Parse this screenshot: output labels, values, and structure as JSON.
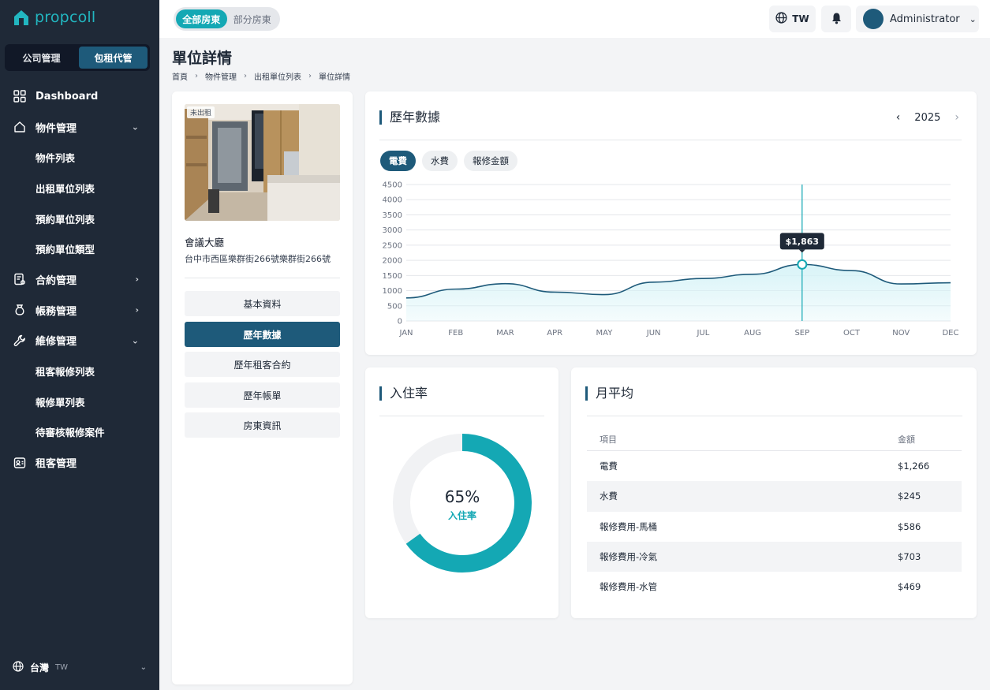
{
  "brand": {
    "name": "propcoll",
    "accent": "#14a8b4",
    "primary": "#1e5a7a"
  },
  "sidebar": {
    "segments": [
      {
        "label": "公司管理",
        "active": false
      },
      {
        "label": "包租代管",
        "active": true
      }
    ],
    "nav": [
      {
        "label": "Dashboard",
        "icon": "grid-icon"
      },
      {
        "label": "物件管理",
        "icon": "home-icon",
        "expanded": true
      },
      {
        "label": "物件列表"
      },
      {
        "label": "出租單位列表"
      },
      {
        "label": "預約單位列表"
      },
      {
        "label": "預約單位類型"
      },
      {
        "label": "合約管理",
        "icon": "contract-icon"
      },
      {
        "label": "帳務管理",
        "icon": "moneybag-icon"
      },
      {
        "label": "維修管理",
        "icon": "wrench-icon",
        "expanded": true
      },
      {
        "label": "租客報修列表"
      },
      {
        "label": "報修單列表"
      },
      {
        "label": "待審核報修案件"
      },
      {
        "label": "租客管理",
        "icon": "tenant-icon"
      }
    ],
    "footer": {
      "label": "台灣",
      "code": "TW"
    }
  },
  "topbar": {
    "toggle": [
      {
        "label": "全部房東",
        "active": true
      },
      {
        "label": "部分房東",
        "active": false
      }
    ],
    "language": "TW",
    "user": "Administrator"
  },
  "page": {
    "title": "單位詳情",
    "breadcrumb": [
      "首頁",
      "物件管理",
      "出租單位列表",
      "單位詳情"
    ]
  },
  "unit": {
    "status_tag": "未出租",
    "name": "會議大廳",
    "address": "台中市西區樂群街266號樂群街266號",
    "menu": [
      {
        "label": "基本資料",
        "active": false
      },
      {
        "label": "歷年數據",
        "active": true
      },
      {
        "label": "歷年租客合約",
        "active": false
      },
      {
        "label": "歷年帳單",
        "active": false
      },
      {
        "label": "房東資訊",
        "active": false
      }
    ]
  },
  "history": {
    "title": "歷年數據",
    "year": "2025",
    "chips": [
      {
        "label": "電費",
        "active": true
      },
      {
        "label": "水費",
        "active": false
      },
      {
        "label": "報修金額",
        "active": false
      }
    ]
  },
  "chart_data": {
    "type": "area",
    "categories": [
      "JAN",
      "FEB",
      "MAR",
      "APR",
      "MAY",
      "JUN",
      "JUL",
      "AUG",
      "SEP",
      "OCT",
      "NOV",
      "DEC"
    ],
    "series": [
      {
        "values": [
          760,
          1050,
          1230,
          950,
          870,
          1280,
          1400,
          1540,
          1863,
          1660,
          1220,
          1260
        ]
      }
    ],
    "ylim": [
      0,
      4500
    ],
    "yticks": [
      0,
      500,
      1000,
      1500,
      2000,
      2500,
      3000,
      3500,
      4000,
      4500
    ],
    "highlight": {
      "index": 8,
      "label": "$1,863"
    },
    "grid": true,
    "line_color": "#1e5a7a",
    "fill_color": "#d6f3f7",
    "marker_color": "#14a8b4"
  },
  "occupancy": {
    "title": "入住率",
    "value_text": "65%",
    "value": 0.65,
    "label": "入住率",
    "color": "#14a8b4",
    "track_color": "#f1f2f4"
  },
  "monthly_avg": {
    "title": "月平均",
    "headers": [
      "項目",
      "金額"
    ],
    "rows": [
      {
        "item": "電費",
        "amount": "$1,266"
      },
      {
        "item": "水費",
        "amount": "$245"
      },
      {
        "item": "報修費用-馬桶",
        "amount": "$586"
      },
      {
        "item": "報修費用-冷氣",
        "amount": "$703"
      },
      {
        "item": "報修費用-水管",
        "amount": "$469"
      }
    ]
  }
}
